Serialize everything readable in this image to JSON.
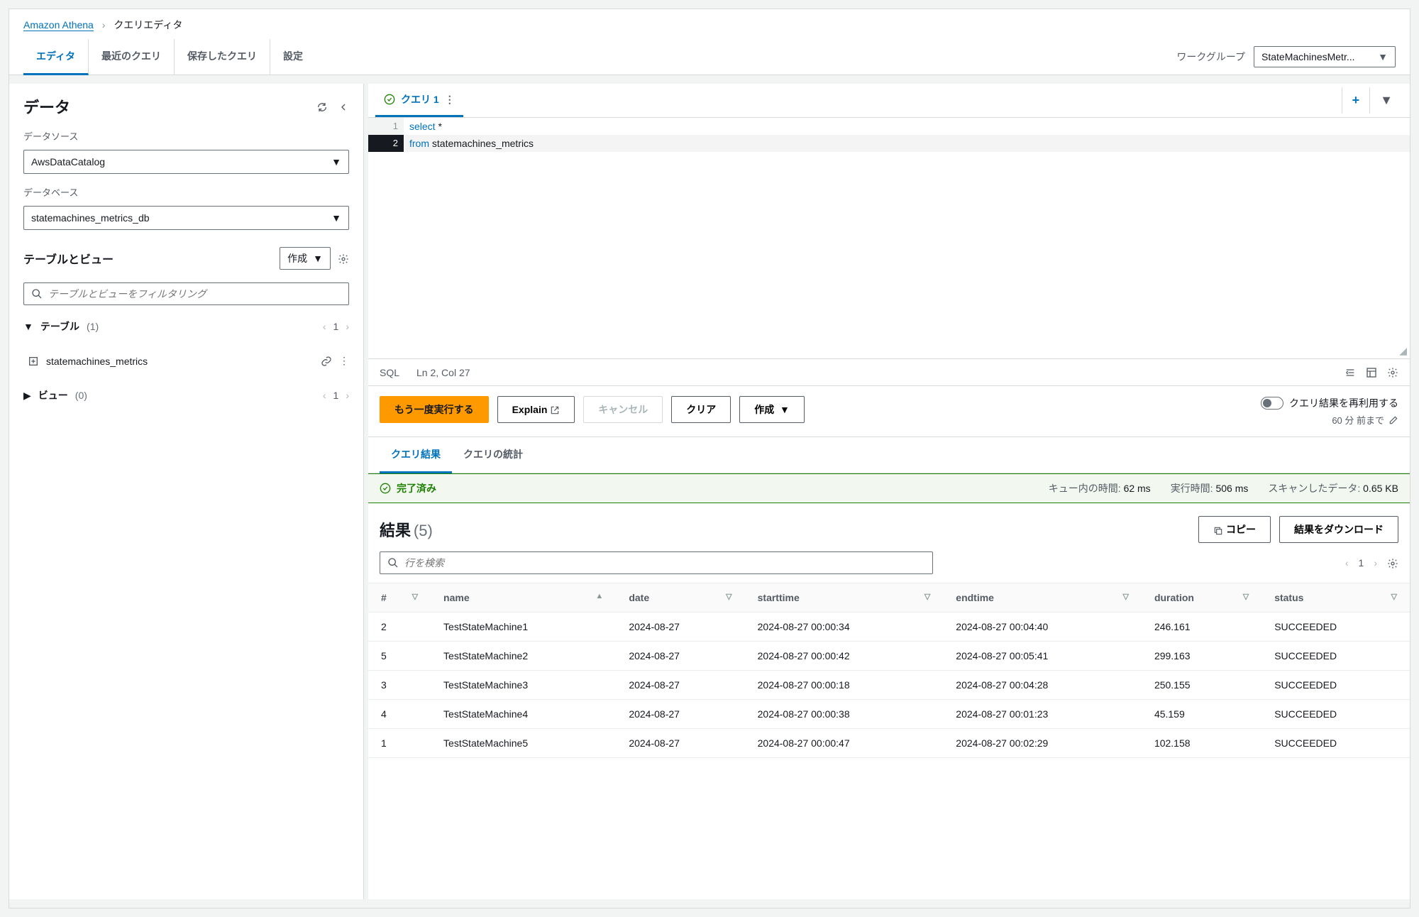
{
  "breadcrumb": {
    "service": "Amazon Athena",
    "page": "クエリエディタ"
  },
  "tabs": {
    "editor": "エディタ",
    "recent": "最近のクエリ",
    "saved": "保存したクエリ",
    "settings": "設定"
  },
  "workgroup": {
    "label": "ワークグループ",
    "value": "StateMachinesMetr..."
  },
  "sidebar": {
    "title": "データ",
    "datasource_label": "データソース",
    "datasource_value": "AwsDataCatalog",
    "database_label": "データベース",
    "database_value": "statemachines_metrics_db",
    "tables_views_title": "テーブルとビュー",
    "create_label": "作成",
    "filter_placeholder": "テーブルとビューをフィルタリング",
    "tables_label": "テーブル",
    "tables_count": "(1)",
    "tables_page": "1",
    "table_item": "statemachines_metrics",
    "views_label": "ビュー",
    "views_count": "(0)",
    "views_page": "1"
  },
  "editor": {
    "tab_label": "クエリ 1",
    "line1_kw": "select",
    "line1_rest": " *",
    "line2_kw": "from",
    "line2_rest": " statemachines_metrics",
    "gutter_1": "1",
    "gutter_2": "2"
  },
  "statusbar": {
    "lang": "SQL",
    "pos": "Ln 2, Col 27"
  },
  "actions": {
    "run": "もう一度実行する",
    "explain": "Explain",
    "cancel": "キャンセル",
    "clear": "クリア",
    "create": "作成",
    "reuse_label": "クエリ結果を再利用する",
    "reuse_sub": "60 分 前まで"
  },
  "result_tabs": {
    "results": "クエリ結果",
    "stats": "クエリの統計"
  },
  "status": {
    "label": "完了済み",
    "queue_label": "キュー内の時間:",
    "queue_value": "62 ms",
    "run_label": "実行時間:",
    "run_value": "506 ms",
    "scan_label": "スキャンしたデータ:",
    "scan_value": "0.65 KB"
  },
  "results": {
    "title": "結果",
    "count": "(5)",
    "copy": "コピー",
    "download": "結果をダウンロード",
    "search_placeholder": "行を検索",
    "page": "1",
    "cols": {
      "idx": "#",
      "name": "name",
      "date": "date",
      "start": "starttime",
      "end": "endtime",
      "duration": "duration",
      "status": "status"
    },
    "rows": [
      {
        "idx": "2",
        "name": "TestStateMachine1",
        "date": "2024-08-27",
        "start": "2024-08-27 00:00:34",
        "end": "2024-08-27 00:04:40",
        "duration": "246.161",
        "status": "SUCCEEDED"
      },
      {
        "idx": "5",
        "name": "TestStateMachine2",
        "date": "2024-08-27",
        "start": "2024-08-27 00:00:42",
        "end": "2024-08-27 00:05:41",
        "duration": "299.163",
        "status": "SUCCEEDED"
      },
      {
        "idx": "3",
        "name": "TestStateMachine3",
        "date": "2024-08-27",
        "start": "2024-08-27 00:00:18",
        "end": "2024-08-27 00:04:28",
        "duration": "250.155",
        "status": "SUCCEEDED"
      },
      {
        "idx": "4",
        "name": "TestStateMachine4",
        "date": "2024-08-27",
        "start": "2024-08-27 00:00:38",
        "end": "2024-08-27 00:01:23",
        "duration": "45.159",
        "status": "SUCCEEDED"
      },
      {
        "idx": "1",
        "name": "TestStateMachine5",
        "date": "2024-08-27",
        "start": "2024-08-27 00:00:47",
        "end": "2024-08-27 00:02:29",
        "duration": "102.158",
        "status": "SUCCEEDED"
      }
    ]
  }
}
